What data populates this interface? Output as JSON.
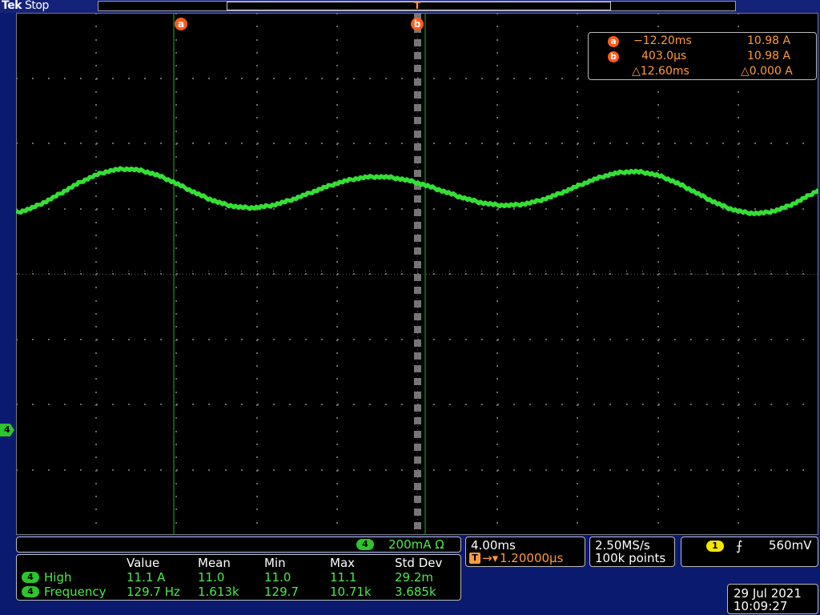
{
  "header": {
    "brand": "Tek",
    "state": "Stop"
  },
  "cursors": {
    "a_label": "a",
    "b_label": "b",
    "trigger_marker": "T"
  },
  "cursor_readout": {
    "a_time": "−12.20ms",
    "a_value": "10.98 A",
    "b_time": "403.0µs",
    "b_value": "10.98 A",
    "delta_time": "△12.60ms",
    "delta_value": "△0.000 A"
  },
  "channel_marker": "4",
  "channel_scale": {
    "channel": "4",
    "scale": "200mA Ω"
  },
  "timebase": {
    "scale": "4.00ms",
    "trigger_position": "1.20000µs"
  },
  "acquisition": {
    "sample_rate": "2.50MS/s",
    "record_length": "100k points"
  },
  "trigger": {
    "channel": "1",
    "level": "560mV"
  },
  "statistics": {
    "headers": [
      "Value",
      "Mean",
      "Min",
      "Max",
      "Std Dev"
    ],
    "rows": [
      {
        "channel": "4",
        "name": "High",
        "values": [
          "11.1 A",
          "11.0",
          "11.0",
          "11.1",
          "29.2m"
        ]
      },
      {
        "channel": "4",
        "name": "Frequency",
        "values": [
          "129.7 Hz",
          "1.613k",
          "129.7",
          "10.71k",
          "3.685k"
        ]
      }
    ]
  },
  "datetime": {
    "date": "29 Jul  2021",
    "time": "10:09:27"
  },
  "colors": {
    "trace": "#34e034",
    "cursor": "#1fb51f",
    "accent_orange": "#ff5a1a",
    "background": "#000000",
    "frame": "#0a1a6e"
  }
}
